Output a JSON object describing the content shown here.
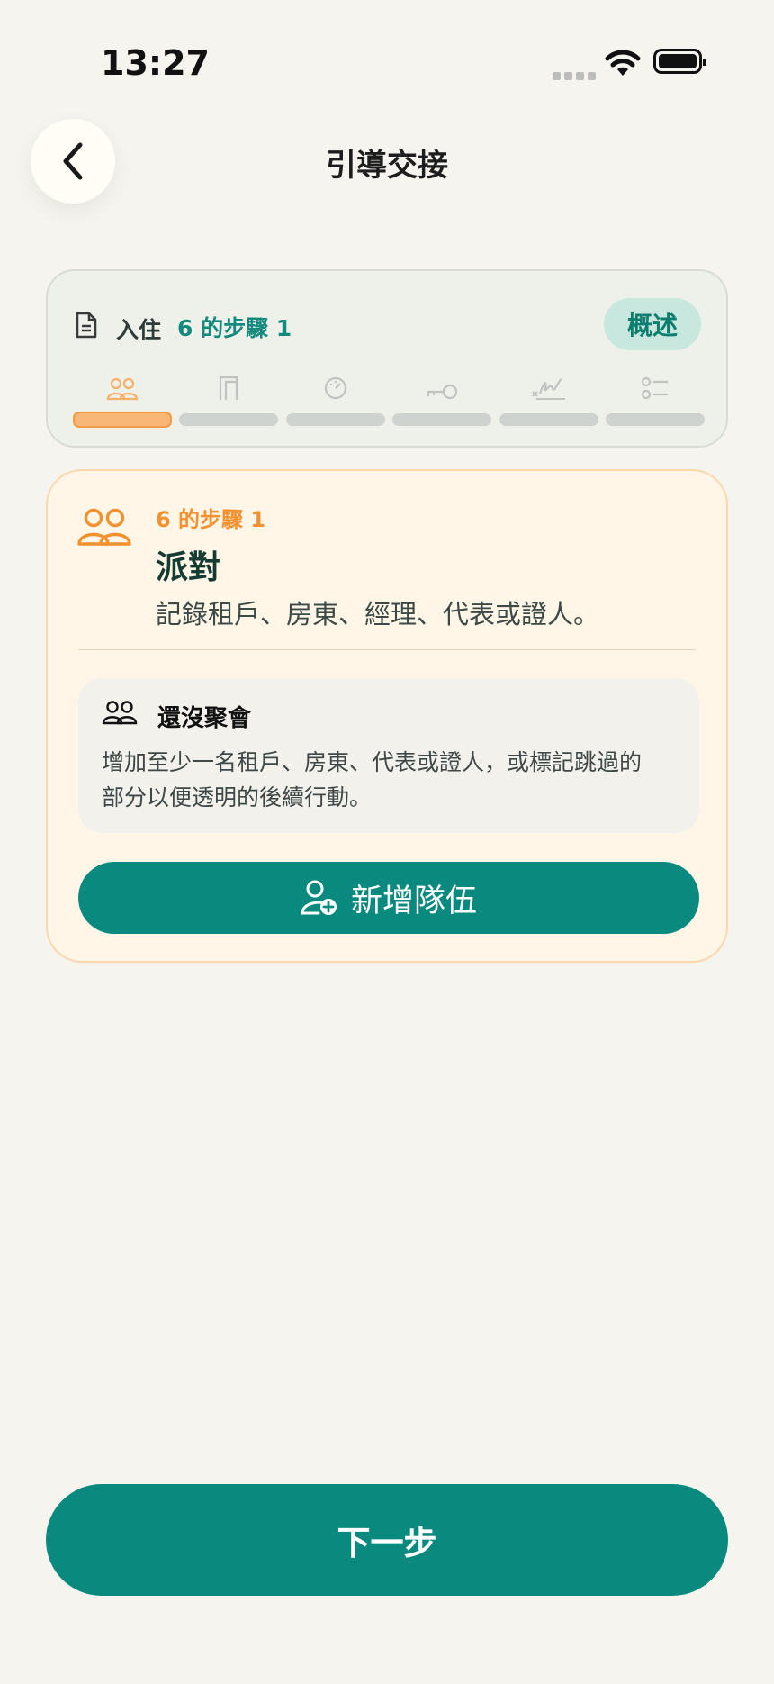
{
  "status_bar": {
    "time": "13:27"
  },
  "header": {
    "title": "引導交接"
  },
  "progress": {
    "flow_name": "入住",
    "step_count": "6 的步驟 1",
    "overview_label": "概述",
    "current_step": 1,
    "total_steps": 6,
    "steps": [
      {
        "icon": "people-icon"
      },
      {
        "icon": "door-icon"
      },
      {
        "icon": "meter-icon"
      },
      {
        "icon": "key-icon"
      },
      {
        "icon": "signature-icon"
      },
      {
        "icon": "checklist-icon"
      }
    ]
  },
  "step_card": {
    "label": "6 的步驟 1",
    "title": "派對",
    "description": "記錄租戶、房東、經理、代表或證人。",
    "empty_title": "還沒聚會",
    "empty_text": "增加至少一名租戶、房東、代表或證人，或標記跳過的部分以便透明的後續行動。",
    "add_button_label": "新增隊伍"
  },
  "footer": {
    "next_label": "下一步"
  },
  "colors": {
    "accent": "#0a8a7f",
    "active_step": "#f29b43",
    "background": "#f5f4ef",
    "card_background": "#fff6e7"
  }
}
